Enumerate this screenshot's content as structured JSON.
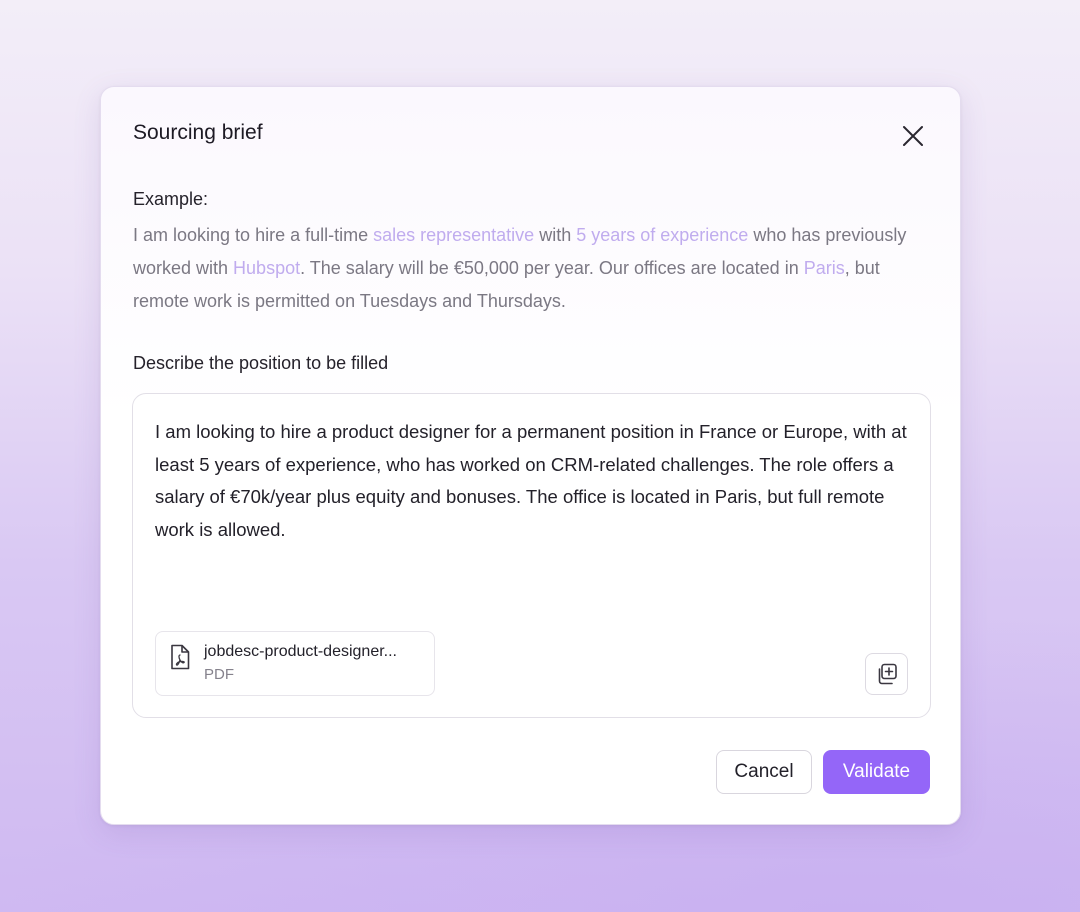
{
  "dialog": {
    "title": "Sourcing brief",
    "close_icon": "close-icon"
  },
  "example": {
    "label": "Example:",
    "segments": [
      {
        "text": "I am looking to hire a full-time ",
        "highlight": false
      },
      {
        "text": "sales representative",
        "highlight": true
      },
      {
        "text": " with ",
        "highlight": false
      },
      {
        "text": "5 years of experience",
        "highlight": true
      },
      {
        "text": " who has previously worked with ",
        "highlight": false
      },
      {
        "text": "Hubspot",
        "highlight": true
      },
      {
        "text": ". The salary will be €50,000 per year. Our offices are located in ",
        "highlight": false
      },
      {
        "text": "Paris",
        "highlight": true
      },
      {
        "text": ", but remote work is permitted on Tuesdays and Thursdays.",
        "highlight": false
      }
    ]
  },
  "description": {
    "label": "Describe the position to be filled",
    "value": "I am looking to hire a product designer for a permanent position in France or Europe, with at least 5 years of experience, who has worked on CRM-related challenges. The role offers a salary of €70k/year plus equity and bonuses. The office is located in Paris, but full remote work is allowed."
  },
  "attachment": {
    "file_name": "jobdesc-product-designer...",
    "file_type": "PDF",
    "icon": "pdf-file-icon"
  },
  "upload_icon": "add-file-icon",
  "actions": {
    "cancel_label": "Cancel",
    "validate_label": "Validate"
  },
  "colors": {
    "accent": "#9466f8",
    "highlight": "#c0acee",
    "muted_text": "#7b7883"
  }
}
